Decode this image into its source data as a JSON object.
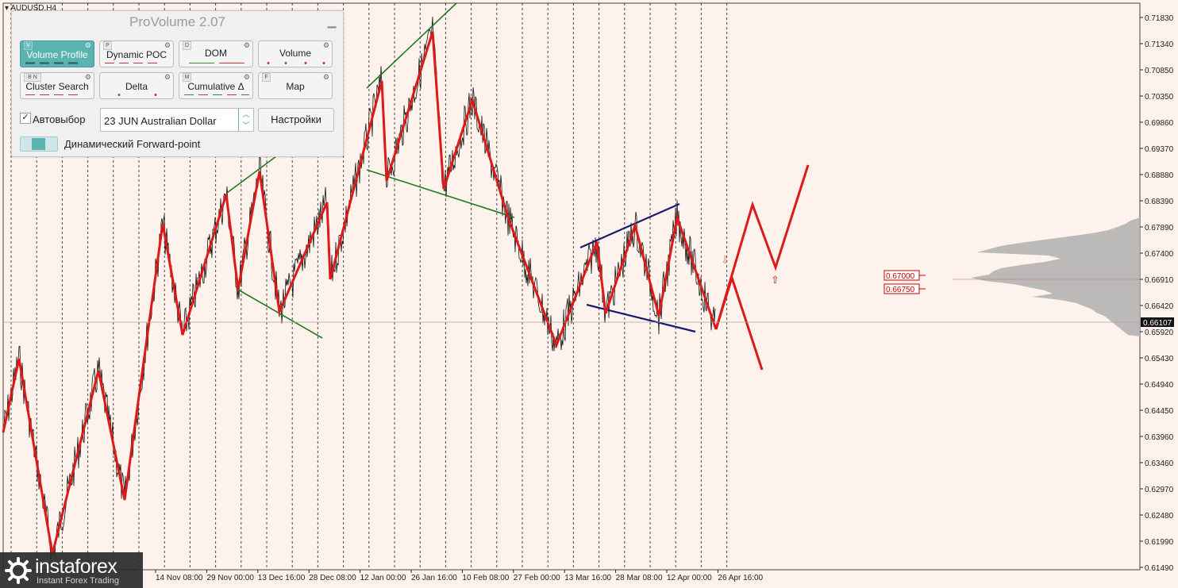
{
  "symbol_label": "AUDUSD,H4",
  "price_axis": {
    "ticks": [
      "0.71830",
      "0.71340",
      "0.70850",
      "0.70350",
      "0.69860",
      "0.69370",
      "0.68880",
      "0.68390",
      "0.67890",
      "0.67400",
      "0.66910",
      "0.66420",
      "0.65920",
      "0.65430",
      "0.64940",
      "0.64450",
      "0.63960",
      "0.63460",
      "0.62970",
      "0.62480",
      "0.61990",
      "0.61490"
    ],
    "current_price": "0.66107"
  },
  "time_axis": {
    "labels": [
      "14 Nov 08:00",
      "29 Nov 00:00",
      "13 Dec 16:00",
      "28 Dec 08:00",
      "12 Jan 00:00",
      "26 Jan 16:00",
      "10 Feb 08:00",
      "27 Feb 00:00",
      "13 Mar 16:00",
      "28 Mar 08:00",
      "12 Apr 00:00",
      "26 Apr 16:00"
    ]
  },
  "levels": [
    {
      "label": "0.67000",
      "color": "#cc0000"
    },
    {
      "label": "0.66750",
      "color": "#cc0000"
    }
  ],
  "panel": {
    "title": "ProVolume 2.07",
    "buttons": [
      {
        "key": "V",
        "label": "Volume Profile",
        "active": true
      },
      {
        "key": "P",
        "label": "Dynamic POC",
        "active": false
      },
      {
        "key": "D",
        "label": "DOM",
        "active": false
      },
      {
        "key": "",
        "label": "Volume",
        "active": false
      },
      {
        "key": "B N",
        "label": "Cluster Search",
        "active": false
      },
      {
        "key": "",
        "label": "Delta",
        "active": false
      },
      {
        "key": "M",
        "label": "Cumulative Δ",
        "active": false
      },
      {
        "key": "F",
        "label": "Map",
        "active": false
      }
    ],
    "auto_select_label": "Автовыбор",
    "auto_select_checked": true,
    "instrument_value": "23 JUN Australian Dollar",
    "settings_label": "Настройки",
    "forward_point_label": "Динамический Forward-point"
  },
  "watermark": {
    "brand": "instaforex",
    "tagline": "Instant Forex Trading"
  },
  "colors": {
    "background": "#fdf3ec",
    "zigzag": "#dd1a1a",
    "channel_green": "#1e7a1e",
    "channel_navy": "#1a1a6e",
    "accent": "#5ab3b0"
  }
}
